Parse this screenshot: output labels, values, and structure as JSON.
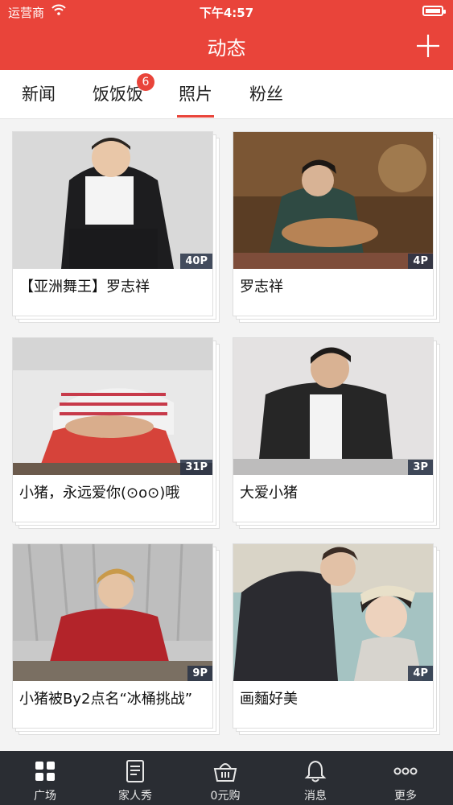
{
  "status_bar": {
    "carrier": "运营商",
    "time": "下午4:57"
  },
  "nav": {
    "title": "动态"
  },
  "tabs": [
    {
      "label": "新闻"
    },
    {
      "label": "饭饭饭",
      "badge": "6"
    },
    {
      "label": "照片",
      "active": true
    },
    {
      "label": "粉丝"
    }
  ],
  "cards": [
    {
      "count": "40P",
      "caption": "【亚洲舞王】罗志祥"
    },
    {
      "count": "4P",
      "caption": "罗志祥"
    },
    {
      "count": "31P",
      "caption": "小猪，永远爱你(⊙o⊙)哦"
    },
    {
      "count": "3P",
      "caption": "大爱小猪"
    },
    {
      "count": "9P",
      "caption": "小猪被By2点名“冰桶挑战”"
    },
    {
      "count": "4P",
      "caption": "画麵好美"
    }
  ],
  "tabbar": [
    {
      "label": "广场",
      "icon": "grid-icon"
    },
    {
      "label": "家人秀",
      "icon": "document-icon"
    },
    {
      "label": "0元购",
      "icon": "basket-icon"
    },
    {
      "label": "消息",
      "icon": "bell-icon"
    },
    {
      "label": "更多",
      "icon": "more-icon"
    }
  ],
  "colors": {
    "accent": "#e9443a",
    "tabbar_bg": "#2a2d33"
  }
}
